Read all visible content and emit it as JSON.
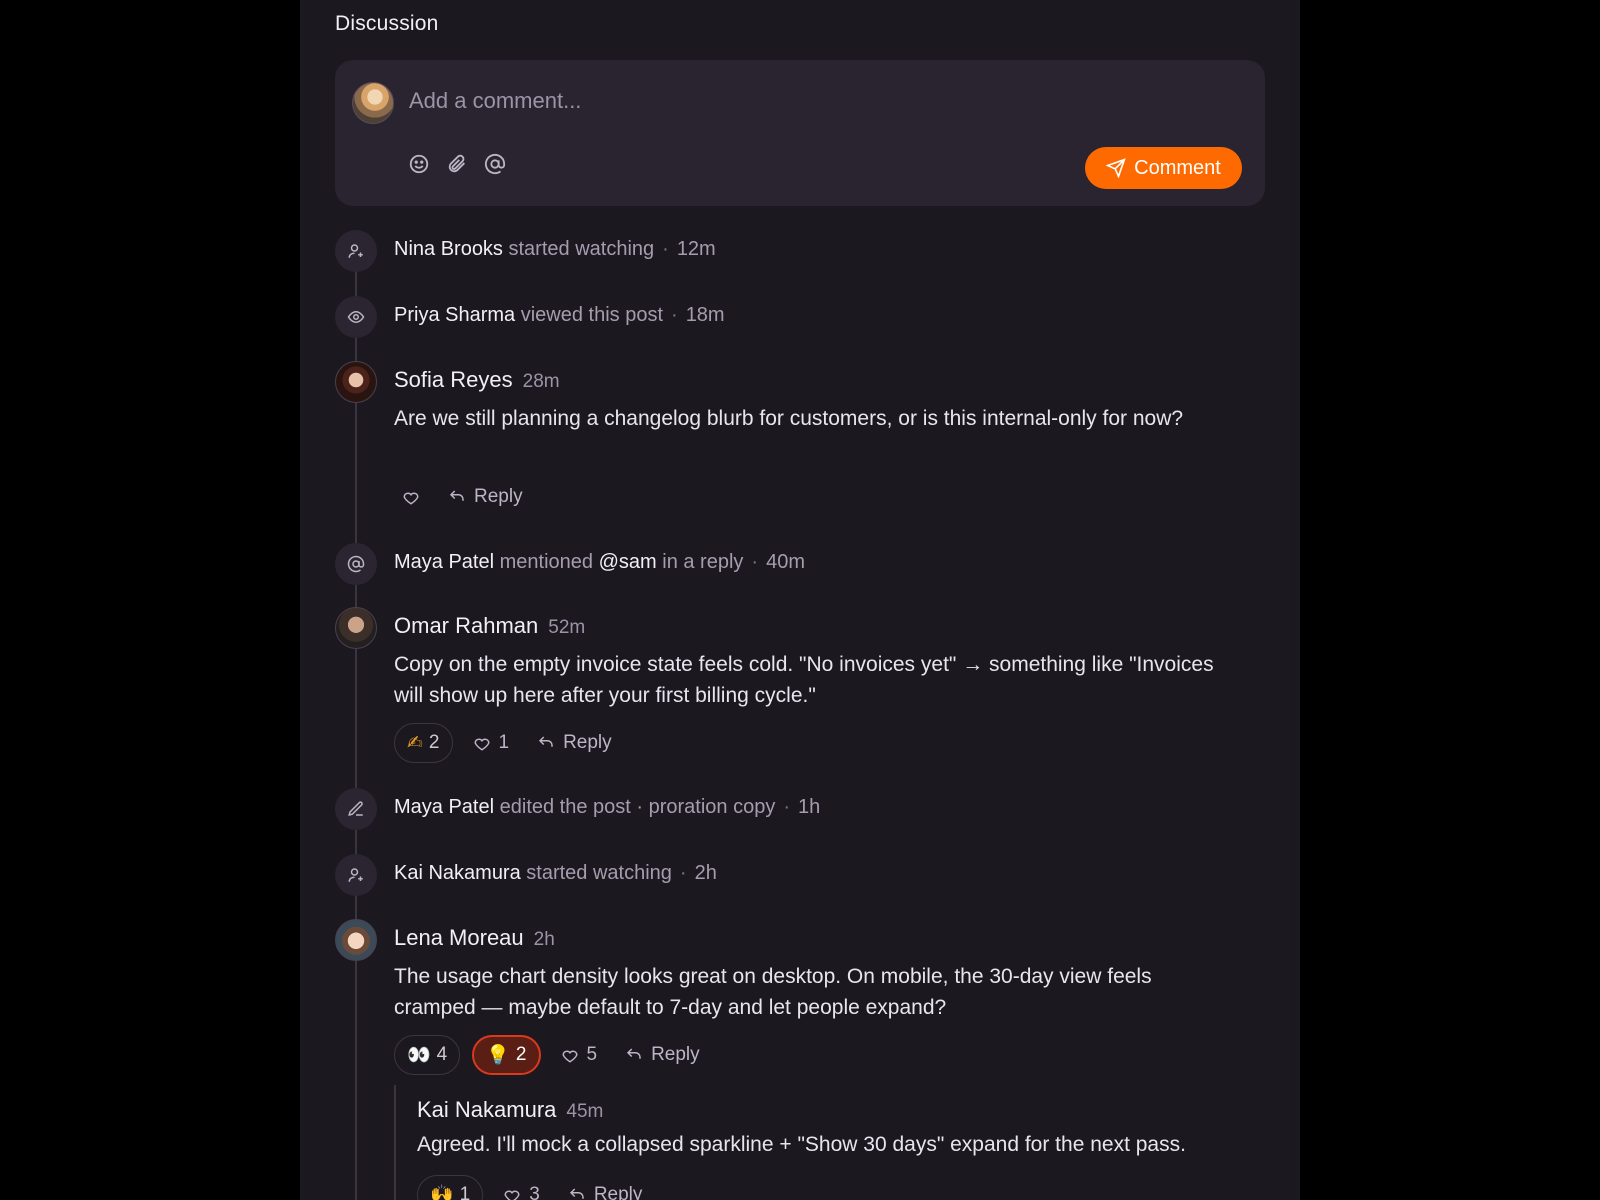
{
  "section_title": "Discussion",
  "composer": {
    "placeholder": "Add a comment...",
    "tools": [
      "emoji-icon",
      "paperclip-icon",
      "at-icon"
    ],
    "submit_label": "Comment",
    "accent": "#ff6a00"
  },
  "activities": [
    {
      "icon": "user-plus-icon",
      "who": "Nina Brooks",
      "text": "started watching",
      "time": "12m"
    },
    {
      "icon": "eye-icon",
      "who": "Priya Sharma",
      "text": "viewed this post",
      "time": "18m"
    },
    {
      "icon": "at-icon",
      "who": "Maya Patel",
      "text_before": "mentioned",
      "mention": "@sam",
      "text_after": "in a reply",
      "time": "40m"
    },
    {
      "icon": "edit-icon",
      "who": "Maya Patel",
      "text": "edited the post · proration copy",
      "time": "1h"
    },
    {
      "icon": "user-plus-icon",
      "who": "Kai Nakamura",
      "text": "started watching",
      "time": "2h"
    }
  ],
  "comments": [
    {
      "author": "Sofia Reyes",
      "time": "28m",
      "body": "Are we still planning a changelog blurb for customers, or is this internal-only for now?",
      "reactions": [],
      "likes": "",
      "reply_label": "Reply"
    },
    {
      "author": "Omar Rahman",
      "time": "52m",
      "body": "Copy on the empty invoice state feels cold. \"No invoices yet\" → something like \"Invoices will show up here after your first billing cycle.\"",
      "reactions": [
        {
          "emoji": "✍",
          "count": "2"
        }
      ],
      "likes": "1",
      "reply_label": "Reply"
    },
    {
      "author": "Lena Moreau",
      "time": "2h",
      "body": "The usage chart density looks great on desktop. On mobile, the 30-day view feels cramped — maybe default to 7-day and let people expand?",
      "reactions": [
        {
          "emoji": "👀",
          "count": "4"
        },
        {
          "emoji": "💡",
          "count": "2",
          "active": true
        }
      ],
      "likes": "5",
      "reply_label": "Reply",
      "replies": [
        {
          "author": "Kai Nakamura",
          "time": "45m",
          "body": "Agreed. I'll mock a collapsed sparkline + \"Show 30 days\" expand for the next pass.",
          "reactions": [
            {
              "emoji": "🙌",
              "count": "1"
            }
          ],
          "likes": "3",
          "reply_label": "Reply"
        }
      ]
    }
  ]
}
